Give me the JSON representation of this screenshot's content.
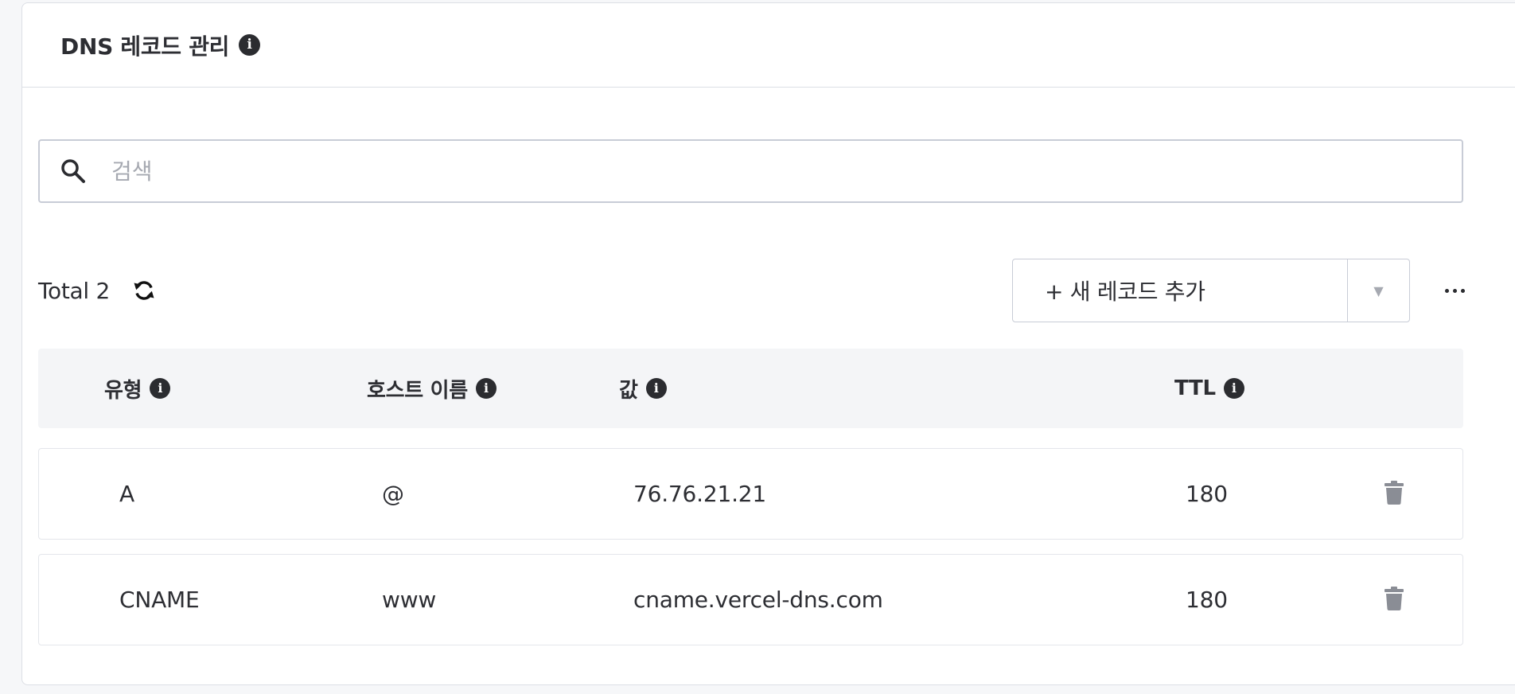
{
  "header": {
    "title": "DNS 레코드 관리"
  },
  "search": {
    "placeholder": "검색"
  },
  "toolbar": {
    "total_label": "Total 2",
    "add_label": "+ 새 레코드 추가",
    "toggle_glyph": "▼"
  },
  "table": {
    "columns": [
      {
        "label": "유형"
      },
      {
        "label": "호스트 이름"
      },
      {
        "label": "값"
      },
      {
        "label": "TTL"
      }
    ],
    "rows": [
      {
        "type": "A",
        "host": "@",
        "value": "76.76.21.21",
        "ttl": "180"
      },
      {
        "type": "CNAME",
        "host": "www",
        "value": "cname.vercel-dns.com",
        "ttl": "180"
      }
    ]
  },
  "icons": {
    "info": "info-icon",
    "search": "search-icon",
    "refresh": "refresh-icon",
    "more": "more-icon",
    "delete": "trash-icon",
    "dropdown": "chevron-down-icon"
  },
  "colors": {
    "icon_dark": "#2b2c30",
    "icon_grey": "#8a8d95",
    "border": "#c8ccd6",
    "header_bg": "#f4f5f7"
  }
}
